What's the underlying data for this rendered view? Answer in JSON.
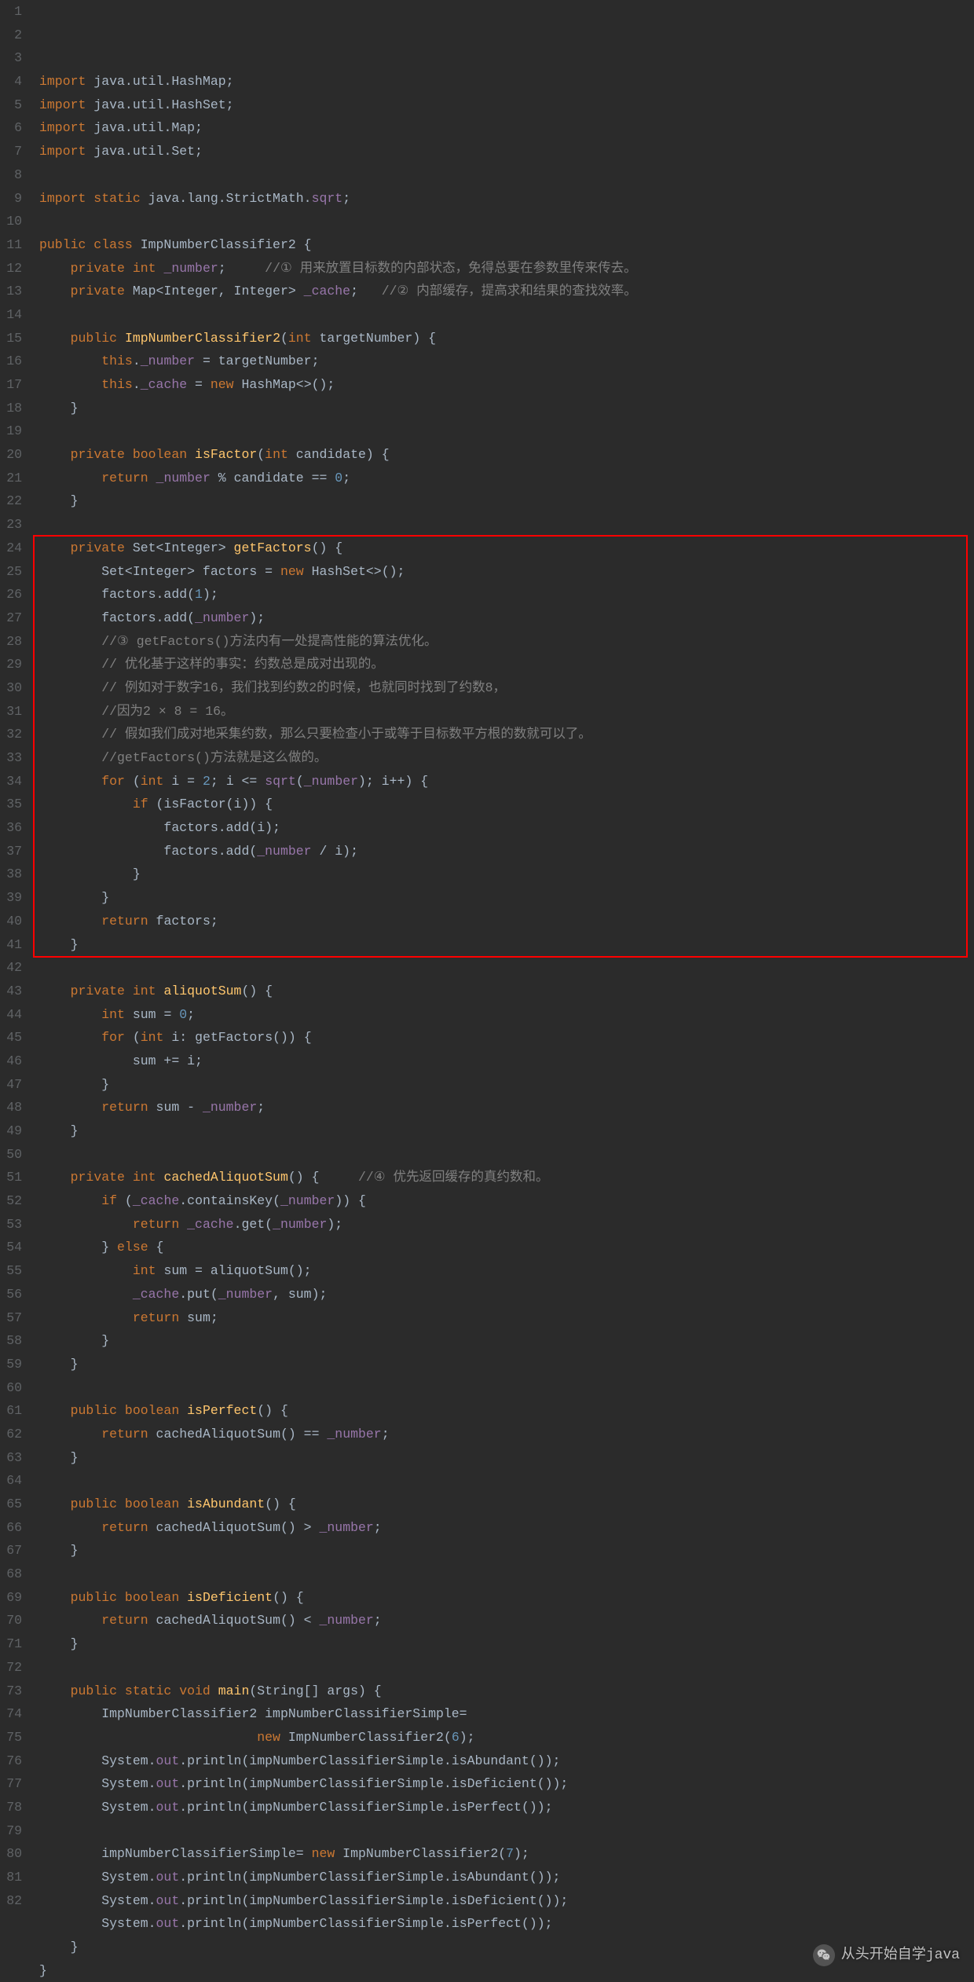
{
  "lines": [
    {
      "n": 1,
      "html": "<span class='kw'>import</span> java.util.HashMap;"
    },
    {
      "n": 2,
      "html": "<span class='kw'>import</span> java.util.HashSet;"
    },
    {
      "n": 3,
      "html": "<span class='kw'>import</span> java.util.Map;"
    },
    {
      "n": 4,
      "html": "<span class='kw'>import</span> java.util.Set;"
    },
    {
      "n": 5,
      "html": ""
    },
    {
      "n": 6,
      "html": "<span class='kw'>import static</span> java.lang.StrictMath.<span class='field'>sqrt</span>;"
    },
    {
      "n": 7,
      "html": ""
    },
    {
      "n": 8,
      "html": "<span class='kw'>public class</span> ImpNumberClassifier2 {"
    },
    {
      "n": 9,
      "html": "    <span class='kw'>private int</span> <span class='field'>_number</span>;     <span class='comment'>//① 用来放置目标数的内部状态，免得总要在参数里传来传去。</span>"
    },
    {
      "n": 10,
      "html": "    <span class='kw'>private</span> Map&lt;Integer, Integer&gt; <span class='field'>_cache</span>;   <span class='comment'>//② 内部缓存，提高求和结果的查找效率。</span>"
    },
    {
      "n": 11,
      "html": ""
    },
    {
      "n": 12,
      "html": "    <span class='kw'>public</span> <span class='method'>ImpNumberClassifier2</span>(<span class='kw'>int</span> targetNumber) {"
    },
    {
      "n": 13,
      "html": "        <span class='kw'>this</span>.<span class='field'>_number</span> = targetNumber;"
    },
    {
      "n": 14,
      "html": "        <span class='kw'>this</span>.<span class='field'>_cache</span> = <span class='kw'>new</span> HashMap&lt;&gt;();"
    },
    {
      "n": 15,
      "html": "    }"
    },
    {
      "n": 16,
      "html": ""
    },
    {
      "n": 17,
      "html": "    <span class='kw'>private boolean</span> <span class='method'>isFactor</span>(<span class='kw'>int</span> candidate) {"
    },
    {
      "n": 18,
      "html": "        <span class='kw'>return</span> <span class='field'>_number</span> % candidate == <span class='num'>0</span>;"
    },
    {
      "n": 19,
      "html": "    }"
    },
    {
      "n": 20,
      "html": ""
    },
    {
      "n": 21,
      "html": "    <span class='kw'>private</span> Set&lt;Integer&gt; <span class='method'>getFactors</span>() {"
    },
    {
      "n": 22,
      "html": "        Set&lt;Integer&gt; factors = <span class='kw'>new</span> HashSet&lt;&gt;();"
    },
    {
      "n": 23,
      "html": "        factors.add(<span class='num'>1</span>);"
    },
    {
      "n": 24,
      "html": "        factors.add(<span class='field'>_number</span>);"
    },
    {
      "n": 25,
      "html": "        <span class='comment'>//③ getFactors()方法内有一处提高性能的算法优化。</span>"
    },
    {
      "n": 26,
      "html": "        <span class='comment'>// 优化基于这样的事实：约数总是成对出现的。</span>"
    },
    {
      "n": 27,
      "html": "        <span class='comment'>// 例如对于数字16，我们找到约数2的时候，也就同时找到了约数8，</span>"
    },
    {
      "n": 28,
      "html": "        <span class='comment'>//因为2 × 8 = 16。</span>"
    },
    {
      "n": 29,
      "html": "        <span class='comment'>// 假如我们成对地采集约数，那么只要检查小于或等于目标数平方根的数就可以了。</span>"
    },
    {
      "n": 30,
      "html": "        <span class='comment'>//getFactors()方法就是这么做的。</span>"
    },
    {
      "n": 31,
      "html": "        <span class='kw'>for</span> (<span class='kw'>int</span> i = <span class='num'>2</span>; i &lt;= <span class='field'>sqrt</span>(<span class='field'>_number</span>); i++) {"
    },
    {
      "n": 32,
      "html": "            <span class='kw'>if</span> (isFactor(i)) {"
    },
    {
      "n": 33,
      "html": "                factors.add(i);"
    },
    {
      "n": 34,
      "html": "                factors.add(<span class='field'>_number</span> / i);"
    },
    {
      "n": 35,
      "html": "            }"
    },
    {
      "n": 36,
      "html": "        }"
    },
    {
      "n": 37,
      "html": "        <span class='kw'>return</span> factors;"
    },
    {
      "n": 38,
      "html": "    }"
    },
    {
      "n": 39,
      "html": ""
    },
    {
      "n": 40,
      "html": "    <span class='kw'>private int</span> <span class='method'>aliquotSum</span>() {"
    },
    {
      "n": 41,
      "html": "        <span class='kw'>int</span> sum = <span class='num'>0</span>;"
    },
    {
      "n": 42,
      "html": "        <span class='kw'>for</span> (<span class='kw'>int</span> i: getFactors()) {"
    },
    {
      "n": 43,
      "html": "            sum += i;"
    },
    {
      "n": 44,
      "html": "        }"
    },
    {
      "n": 45,
      "html": "        <span class='kw'>return</span> sum - <span class='field'>_number</span>;"
    },
    {
      "n": 46,
      "html": "    }"
    },
    {
      "n": 47,
      "html": ""
    },
    {
      "n": 48,
      "html": "    <span class='kw'>private int</span> <span class='method'>cachedAliquotSum</span>() {     <span class='comment'>//④ 优先返回缓存的真约数和。</span>"
    },
    {
      "n": 49,
      "html": "        <span class='kw'>if</span> (<span class='field'>_cache</span>.containsKey(<span class='field'>_number</span>)) {"
    },
    {
      "n": 50,
      "html": "            <span class='kw'>return</span> <span class='field'>_cache</span>.get(<span class='field'>_number</span>);"
    },
    {
      "n": 51,
      "html": "        } <span class='kw'>else</span> {"
    },
    {
      "n": 52,
      "html": "            <span class='kw'>int</span> sum = aliquotSum();"
    },
    {
      "n": 53,
      "html": "            <span class='field'>_cache</span>.put(<span class='field'>_number</span>, sum);"
    },
    {
      "n": 54,
      "html": "            <span class='kw'>return</span> sum;"
    },
    {
      "n": 55,
      "html": "        }"
    },
    {
      "n": 56,
      "html": "    }"
    },
    {
      "n": 57,
      "html": ""
    },
    {
      "n": 58,
      "html": "    <span class='kw'>public boolean</span> <span class='method'>isPerfect</span>() {"
    },
    {
      "n": 59,
      "html": "        <span class='kw'>return</span> cachedAliquotSum() == <span class='field'>_number</span>;"
    },
    {
      "n": 60,
      "html": "    }"
    },
    {
      "n": 61,
      "html": ""
    },
    {
      "n": 62,
      "html": "    <span class='kw'>public boolean</span> <span class='method'>isAbundant</span>() {"
    },
    {
      "n": 63,
      "html": "        <span class='kw'>return</span> cachedAliquotSum() &gt; <span class='field'>_number</span>;"
    },
    {
      "n": 64,
      "html": "    }"
    },
    {
      "n": 65,
      "html": ""
    },
    {
      "n": 66,
      "html": "    <span class='kw'>public boolean</span> <span class='method'>isDeficient</span>() {"
    },
    {
      "n": 67,
      "html": "        <span class='kw'>return</span> cachedAliquotSum() &lt; <span class='field'>_number</span>;"
    },
    {
      "n": 68,
      "html": "    }"
    },
    {
      "n": 69,
      "html": ""
    },
    {
      "n": 70,
      "html": "    <span class='kw'>public static void</span> <span class='method'>main</span>(String[] args) {"
    },
    {
      "n": 71,
      "html": "        ImpNumberClassifier2 impNumberClassifierSimple="
    },
    {
      "n": 72,
      "html": "                            <span class='kw'>new</span> ImpNumberClassifier2(<span class='num'>6</span>);"
    },
    {
      "n": 73,
      "html": "        System.<span class='field'>out</span>.println(impNumberClassifierSimple.isAbundant());"
    },
    {
      "n": 74,
      "html": "        System.<span class='field'>out</span>.println(impNumberClassifierSimple.isDeficient());"
    },
    {
      "n": 75,
      "html": "        System.<span class='field'>out</span>.println(impNumberClassifierSimple.isPerfect());"
    },
    {
      "n": 76,
      "html": ""
    },
    {
      "n": 77,
      "html": "        impNumberClassifierSimple= <span class='kw'>new</span> ImpNumberClassifier2(<span class='num'>7</span>);"
    },
    {
      "n": 78,
      "html": "        System.<span class='field'>out</span>.println(impNumberClassifierSimple.isAbundant());"
    },
    {
      "n": 79,
      "html": "        System.<span class='field'>out</span>.println(impNumberClassifierSimple.isDeficient());"
    },
    {
      "n": 80,
      "html": "        System.<span class='field'>out</span>.println(impNumberClassifierSimple.isPerfect());"
    },
    {
      "n": 81,
      "html": "    }"
    },
    {
      "n": 82,
      "html": "}"
    }
  ],
  "highlight": {
    "startLine": 21,
    "endLine": 38
  },
  "watermark": {
    "text": "从头开始自学java"
  }
}
